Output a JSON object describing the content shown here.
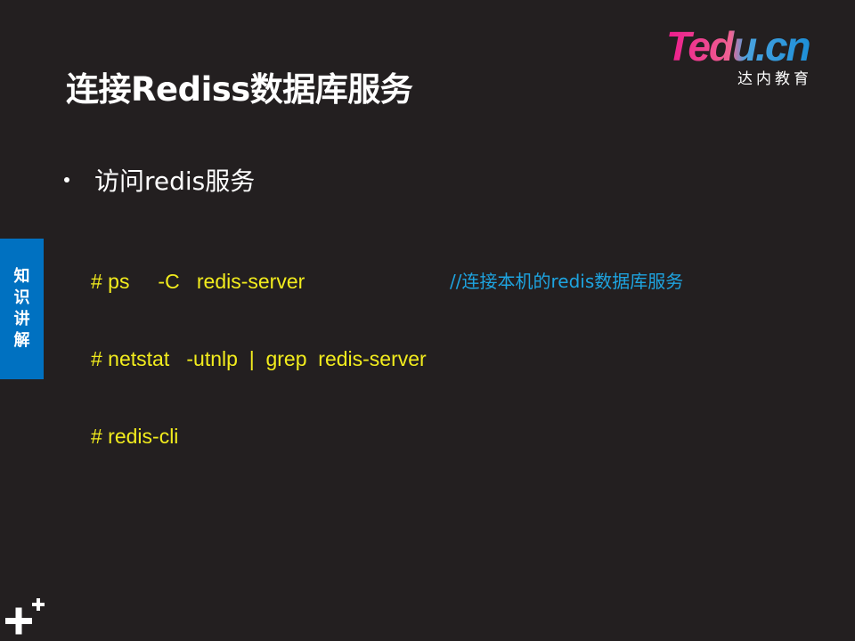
{
  "slide": {
    "title": "连接Rediss数据库服务",
    "bullet": "访问redis服务",
    "code_lines": [
      "# ps     -C   redis-server",
      "# netstat   -utnlp  |  grep  redis-server",
      "# redis-cli"
    ],
    "comment": "//连接本机的redis数据库服务"
  },
  "logo": {
    "brand": "Tedu.cn",
    "subtitle": "达内教育"
  },
  "side_tab": {
    "chars": [
      "知",
      "识",
      "讲",
      "解"
    ]
  },
  "colors": {
    "background": "#231f20",
    "code": "#f2ec1d",
    "comment": "#1ea4e0",
    "side_tab": "#0071c1",
    "logo_pink": "#ec1a8c",
    "logo_blue": "#1d8fd8"
  },
  "icons": {
    "corner": "plus-mark-icon"
  }
}
